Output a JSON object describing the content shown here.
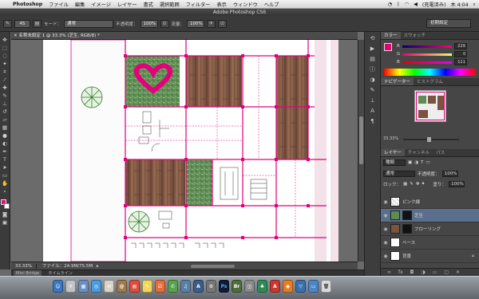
{
  "menubar": {
    "apple": "",
    "app_name": "Photoshop",
    "items": [
      "ファイル",
      "編集",
      "イメージ",
      "レイヤー",
      "書式",
      "選択範囲",
      "フィルター",
      "表示",
      "ウィンドウ",
      "ヘルプ"
    ],
    "battery": "(充電済み)",
    "clock": "木 4:04"
  },
  "window": {
    "title": "Adobe Photoshop CS6"
  },
  "options_bar": {
    "mode_label": "モード：",
    "mode_value": "通常",
    "opacity_label": "不透明度：",
    "opacity_value": "100%",
    "flow_label": "流量：",
    "flow_value": "100%",
    "brush_size": "45",
    "workspace": "初期設定"
  },
  "document": {
    "tab_title": "名称未設定 1 @ 33.3% (芝生, RGB/8) *",
    "zoom": "33.33%",
    "file_info": "ファイル：24.9M/75.5M"
  },
  "mini_bar": {
    "tabs": [
      "Mini Bridge",
      "タイムライン"
    ]
  },
  "color_panel": {
    "tabs": [
      "カラー",
      "スウォッチ"
    ],
    "channels": [
      {
        "label": "R",
        "value": "229"
      },
      {
        "label": "G",
        "value": "0"
      },
      {
        "label": "B",
        "value": "111"
      }
    ],
    "foreground": "#e5006f"
  },
  "navigator_panel": {
    "tabs": [
      "ナビゲーター",
      "ヒストグラム"
    ],
    "zoom": "33.33%"
  },
  "layers_panel": {
    "tabs": [
      "レイヤー",
      "チャンネル",
      "パス"
    ],
    "kind": "種類",
    "blend": "通常",
    "opacity_label": "不透明度：",
    "opacity_value": "100%",
    "lock_label": "ロック：",
    "fill_label": "塗り：",
    "fill_value": "100%",
    "layers": [
      {
        "name": "ピンク線",
        "selected": false
      },
      {
        "name": "芝生",
        "selected": true
      },
      {
        "name": "フローリング",
        "selected": false
      },
      {
        "name": "ベース",
        "selected": false
      },
      {
        "name": "背景",
        "selected": false
      }
    ]
  },
  "dock": {
    "ps_label": "Ps"
  }
}
